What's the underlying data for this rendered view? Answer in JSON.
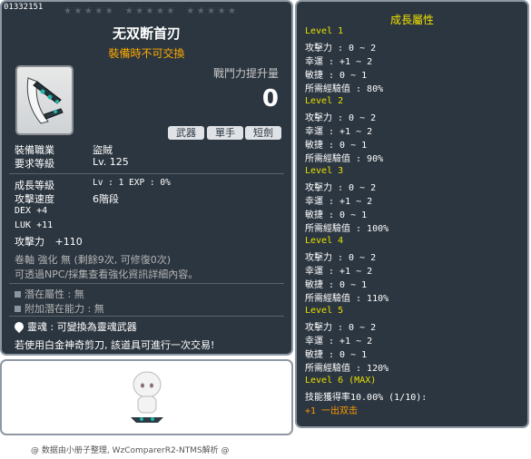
{
  "item": {
    "id": "01332151",
    "name": "无双断首刃",
    "trade_note": "裝備時不可交換",
    "power_label": "戰鬥力提升量",
    "power_value": "0",
    "tags": [
      "武器",
      "單手",
      "短劍"
    ],
    "job_label": "裝備職業",
    "job_value": "盜賊",
    "req_level_label": "要求等級",
    "req_level_value": "Lv. 125",
    "growth_label": "成長等級",
    "growth_value": "Lv : 1   EXP : 0%",
    "speed_label": "攻擊速度",
    "speed_value": "6階段",
    "dex": "DEX   +4",
    "luk": "LUK   +11",
    "atk_label": "攻擊力",
    "atk_value": "+110",
    "scroll_line": "卷軸 強化 無 (剩餘9次, 可修復0次)",
    "enhance_info": "可透過NPC/採集查看強化資訊詳細內容。",
    "potential": "潛在屬性  : 無",
    "extra_potential": "附加潛在能力  : 無",
    "soul": "靈魂  : 可變換為靈魂武器",
    "scissors": "若使用白金神奇剪刀, 該道具可進行一次交易!"
  },
  "growth": {
    "title": "成長屬性",
    "levels": [
      {
        "level": "Level 1",
        "lines": [
          "攻擊力 : 0 ~ 2",
          "幸運 : +1 ~ 2",
          "敏捷 : 0 ~ 1",
          "所需經驗值 : 80%"
        ]
      },
      {
        "level": "Level 2",
        "lines": [
          "攻擊力 : 0 ~ 2",
          "幸運 : +1 ~ 2",
          "敏捷 : 0 ~ 1",
          "所需經驗值 : 90%"
        ]
      },
      {
        "level": "Level 3",
        "lines": [
          "攻擊力 : 0 ~ 2",
          "幸運 : +1 ~ 2",
          "敏捷 : 0 ~ 1",
          "所需經驗值 : 100%"
        ]
      },
      {
        "level": "Level 4",
        "lines": [
          "攻擊力 : 0 ~ 2",
          "幸運 : +1 ~ 2",
          "敏捷 : 0 ~ 1",
          "所需經驗值 : 110%"
        ]
      },
      {
        "level": "Level 5",
        "lines": [
          "攻擊力 : 0 ~ 2",
          "幸運 : +1 ~ 2",
          "敏捷 : 0 ~ 1",
          "所需經驗值 : 120%"
        ]
      }
    ],
    "max_level": "Level 6 (MAX)",
    "skill_rate": "技能獲得率10.00% (1/10):",
    "skill_name": "+1 一出双击"
  },
  "footer": "@ 数据由小册子整理, WzComparerR2-NTMS解析 @"
}
